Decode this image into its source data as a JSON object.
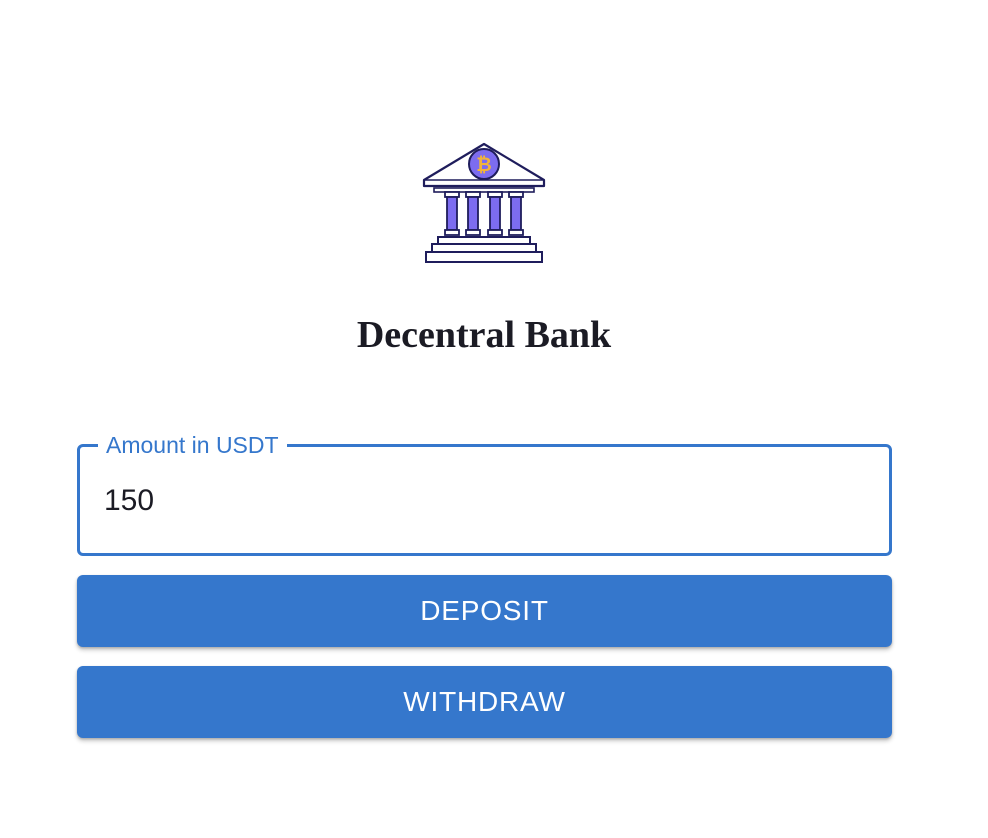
{
  "logo": {
    "icon": "bank-bitcoin-icon",
    "colors": {
      "outline": "#1f1d5c",
      "pillar": "#7c6cf0",
      "coin": "#7c6cf0",
      "coin_symbol": "#f2b43a"
    }
  },
  "header": {
    "title": "Decentral Bank"
  },
  "amount_field": {
    "label": "Amount in USDT",
    "value": "150"
  },
  "actions": {
    "deposit_label": "DEPOSIT",
    "withdraw_label": "WITHDRAW"
  },
  "theme": {
    "accent": "#3577cc",
    "text": "#1b1b24",
    "background": "#ffffff"
  }
}
